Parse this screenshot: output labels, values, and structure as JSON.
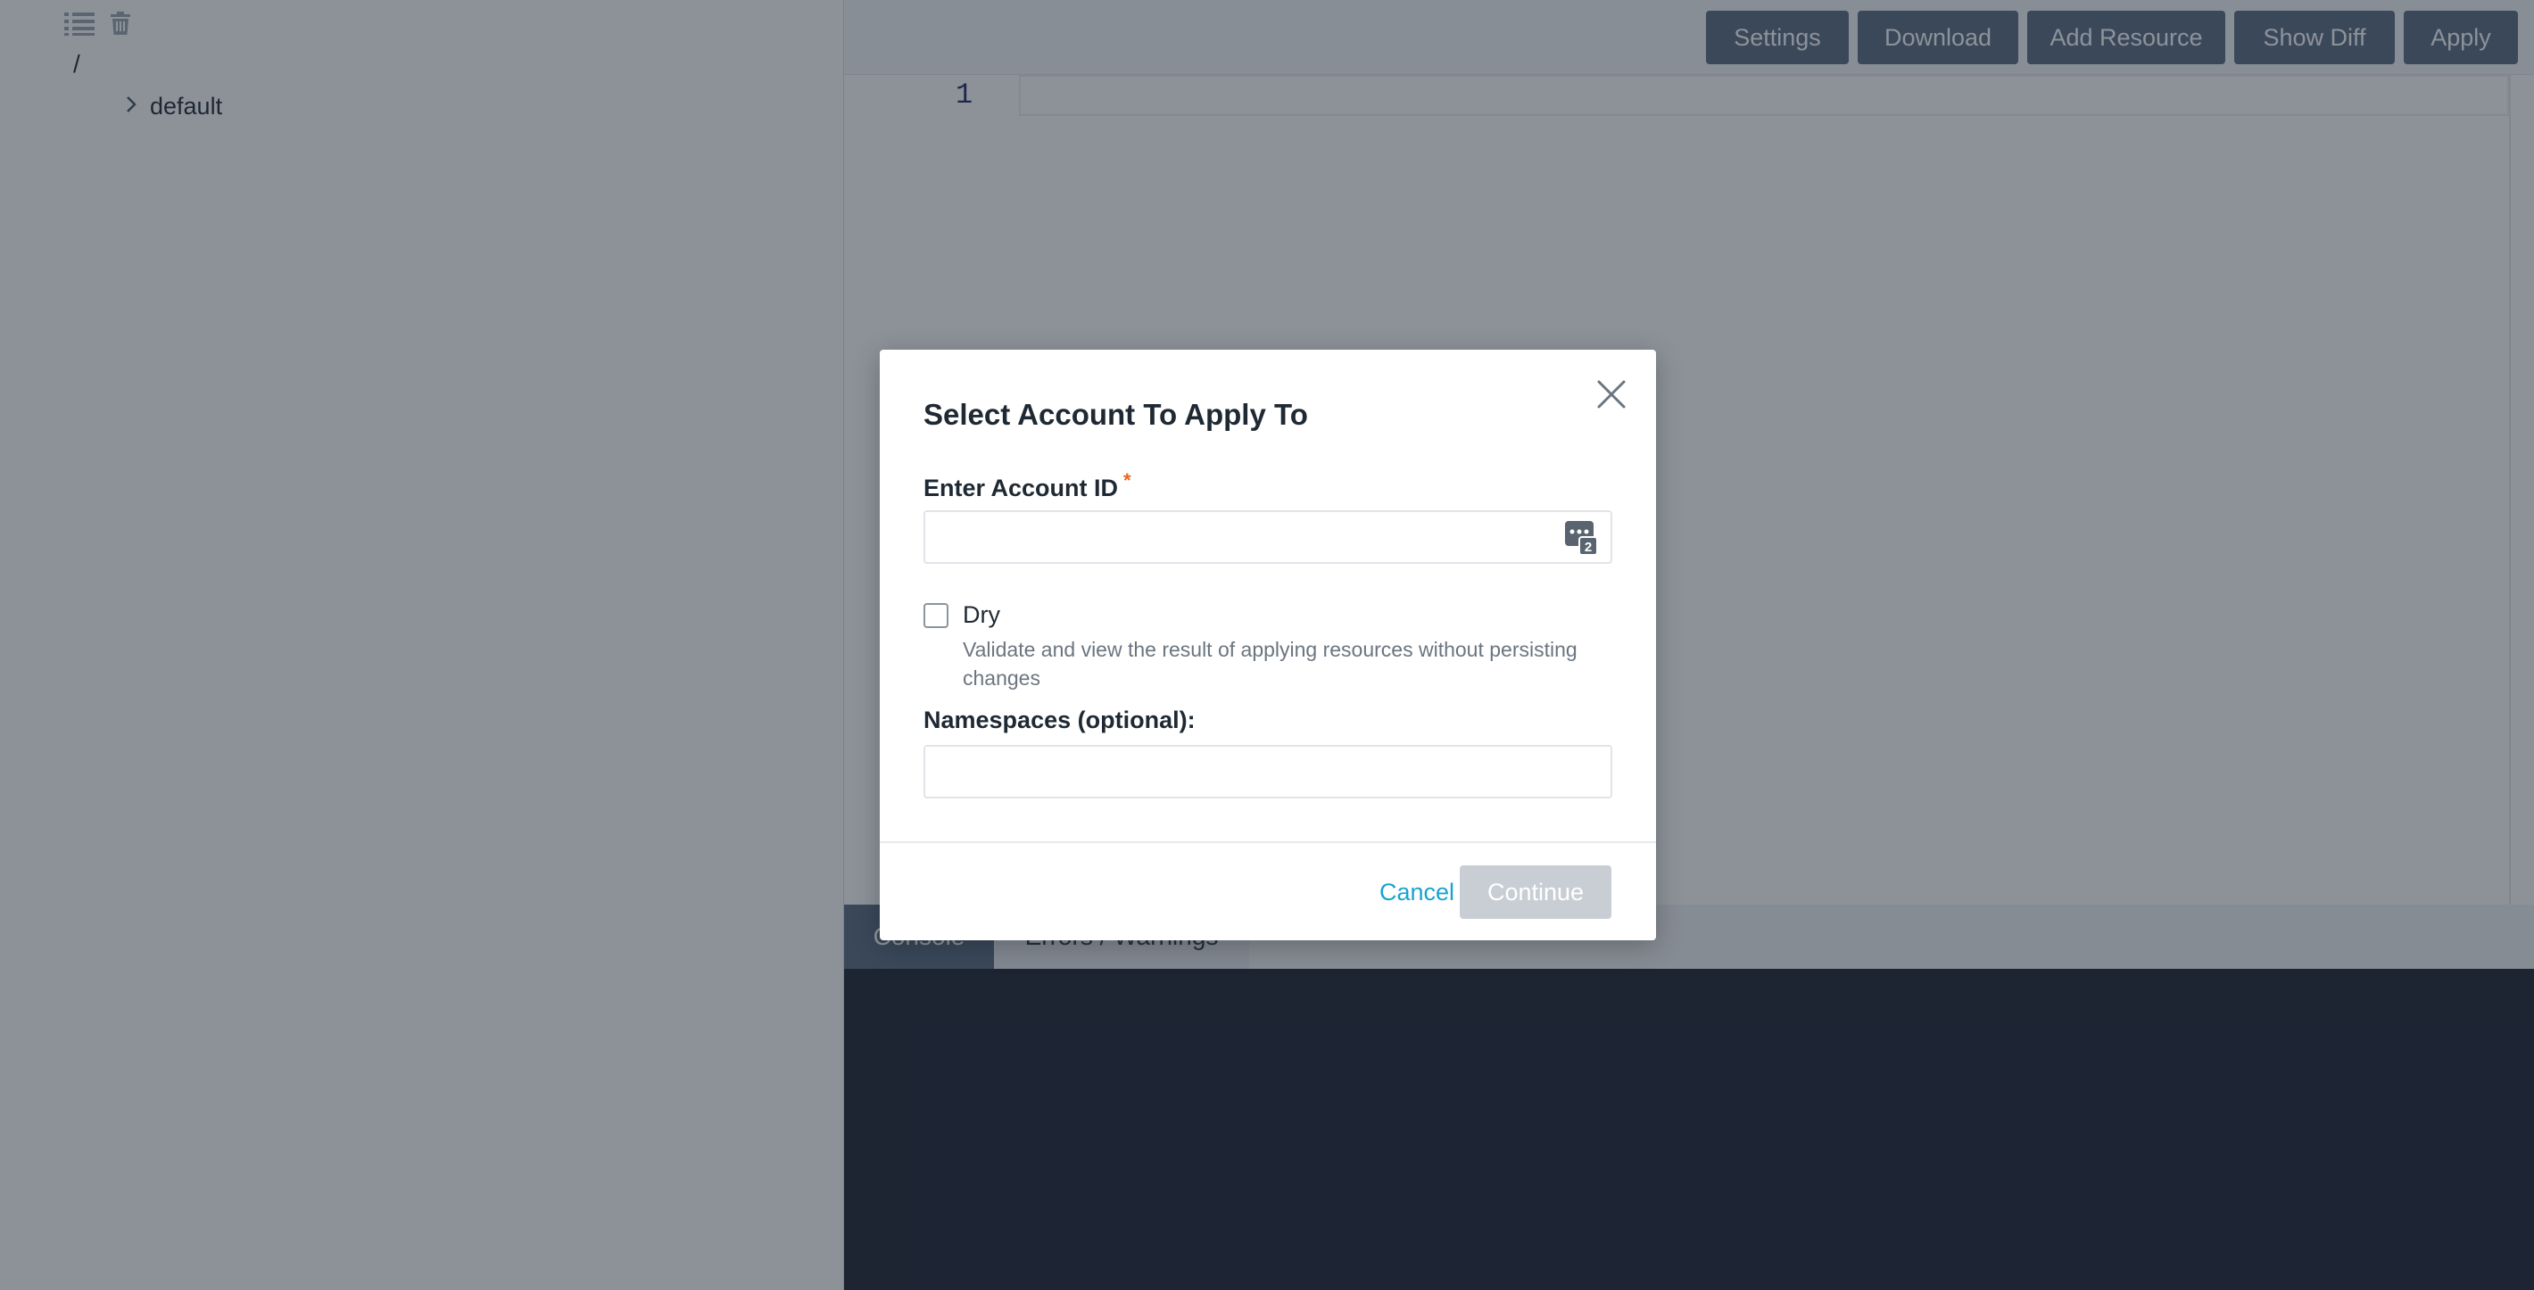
{
  "sidebar": {
    "toolbar": {
      "list_icon": "list-icon",
      "delete_icon": "trash-icon"
    },
    "tree": {
      "root_label": "/",
      "nodes": [
        {
          "label": "default",
          "icon": "chevron-right-icon"
        }
      ]
    }
  },
  "toolbar": {
    "settings_label": "Settings",
    "download_label": "Download",
    "add_resource_label": "Add Resource",
    "show_diff_label": "Show Diff",
    "apply_label": "Apply"
  },
  "editor": {
    "line_number": "1",
    "content": ""
  },
  "console": {
    "tabs": [
      {
        "label": "Console"
      },
      {
        "label": "Errors / Warnings"
      }
    ]
  },
  "modal": {
    "title": "Select Account To Apply To",
    "account_id": {
      "label": "Enter Account ID",
      "required_marker": "*",
      "value": "",
      "placeholder": ""
    },
    "dry": {
      "label": "Dry",
      "checked": false,
      "help": "Validate and view the result of applying resources without persisting changes"
    },
    "namespaces": {
      "label": "Namespaces (optional):",
      "value": "",
      "placeholder": ""
    },
    "cancel_label": "Cancel",
    "continue_label": "Continue"
  },
  "colors": {
    "toolbar_button": "#596b80",
    "link": "#1aa3cf",
    "required": "#e8661e",
    "disabled_button": "#c9ced5",
    "console_bg": "#1e2433"
  }
}
